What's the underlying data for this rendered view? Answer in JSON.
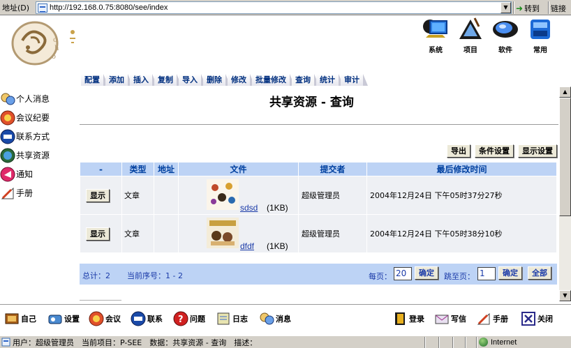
{
  "browser": {
    "address_label": "地址(D)",
    "url": "http://192.168.0.75:8080/see/index",
    "go_label": "转到",
    "links_label": "链接"
  },
  "header": {
    "top_icons": [
      {
        "label": "系统",
        "icon": "system-icon"
      },
      {
        "label": "项目",
        "icon": "project-icon"
      },
      {
        "label": "软件",
        "icon": "software-icon"
      },
      {
        "label": "常用",
        "icon": "common-icon"
      }
    ]
  },
  "tabs": [
    "配置",
    "添加",
    "插入",
    "复制",
    "导入",
    "删除",
    "修改",
    "批量修改",
    "查询",
    "统计",
    "审计"
  ],
  "active_tab": "查询",
  "sidebar": {
    "items": [
      {
        "label": "个人消息",
        "icon": "personal-message-icon"
      },
      {
        "label": "会议纪要",
        "icon": "meeting-icon"
      },
      {
        "label": "联系方式",
        "icon": "contact-icon"
      },
      {
        "label": "共享资源",
        "icon": "shared-resource-icon"
      },
      {
        "label": "通知",
        "icon": "notice-icon"
      },
      {
        "label": "手册",
        "icon": "manual-icon"
      }
    ]
  },
  "main": {
    "title": "共享资源 - 查询",
    "buttons": {
      "export": "导出",
      "condition": "条件设置",
      "display": "显示设置"
    },
    "table": {
      "columns": [
        "-",
        "类型",
        "地址",
        "文件",
        "提交者",
        "最后修改时间"
      ],
      "rows": [
        {
          "action": "显示",
          "type": "文章",
          "address": "",
          "file_name": "sdsd",
          "file_size": "(1KB)",
          "submitter": "超级管理员",
          "modified": "2004年12月24日 下午05时37分27秒"
        },
        {
          "action": "显示",
          "type": "文章",
          "address": "",
          "file_name": "dfdf",
          "file_size": "(1KB)",
          "submitter": "超级管理员",
          "modified": "2004年12月24日 下午05时38分10秒"
        }
      ]
    },
    "footer": {
      "total": "总计：2",
      "current": "当前序号：1 - 2",
      "per_page_label": "每页：",
      "per_page_value": "20",
      "confirm": "确定",
      "jump_label": "跳至页：",
      "jump_value": "1",
      "confirm2": "确定",
      "all": "全部"
    }
  },
  "bottom_toolbar": {
    "left": [
      {
        "label": "自己",
        "icon": "self-icon"
      },
      {
        "label": "设置",
        "icon": "settings-icon"
      },
      {
        "label": "会议",
        "icon": "meeting-icon"
      },
      {
        "label": "联系",
        "icon": "contact-icon"
      },
      {
        "label": "问题",
        "icon": "question-icon"
      },
      {
        "label": "日志",
        "icon": "log-icon"
      },
      {
        "label": "消息",
        "icon": "message-icon"
      }
    ],
    "right": [
      {
        "label": "登录",
        "icon": "login-icon"
      },
      {
        "label": "写信",
        "icon": "mail-icon"
      },
      {
        "label": "手册",
        "icon": "manual-icon"
      },
      {
        "label": "关闭",
        "icon": "close-icon"
      }
    ]
  },
  "status": {
    "text": "用户：超级管理员　当前项目：P-SEE　数据：共享资源 - 查询　描述：",
    "zone": "Internet"
  }
}
